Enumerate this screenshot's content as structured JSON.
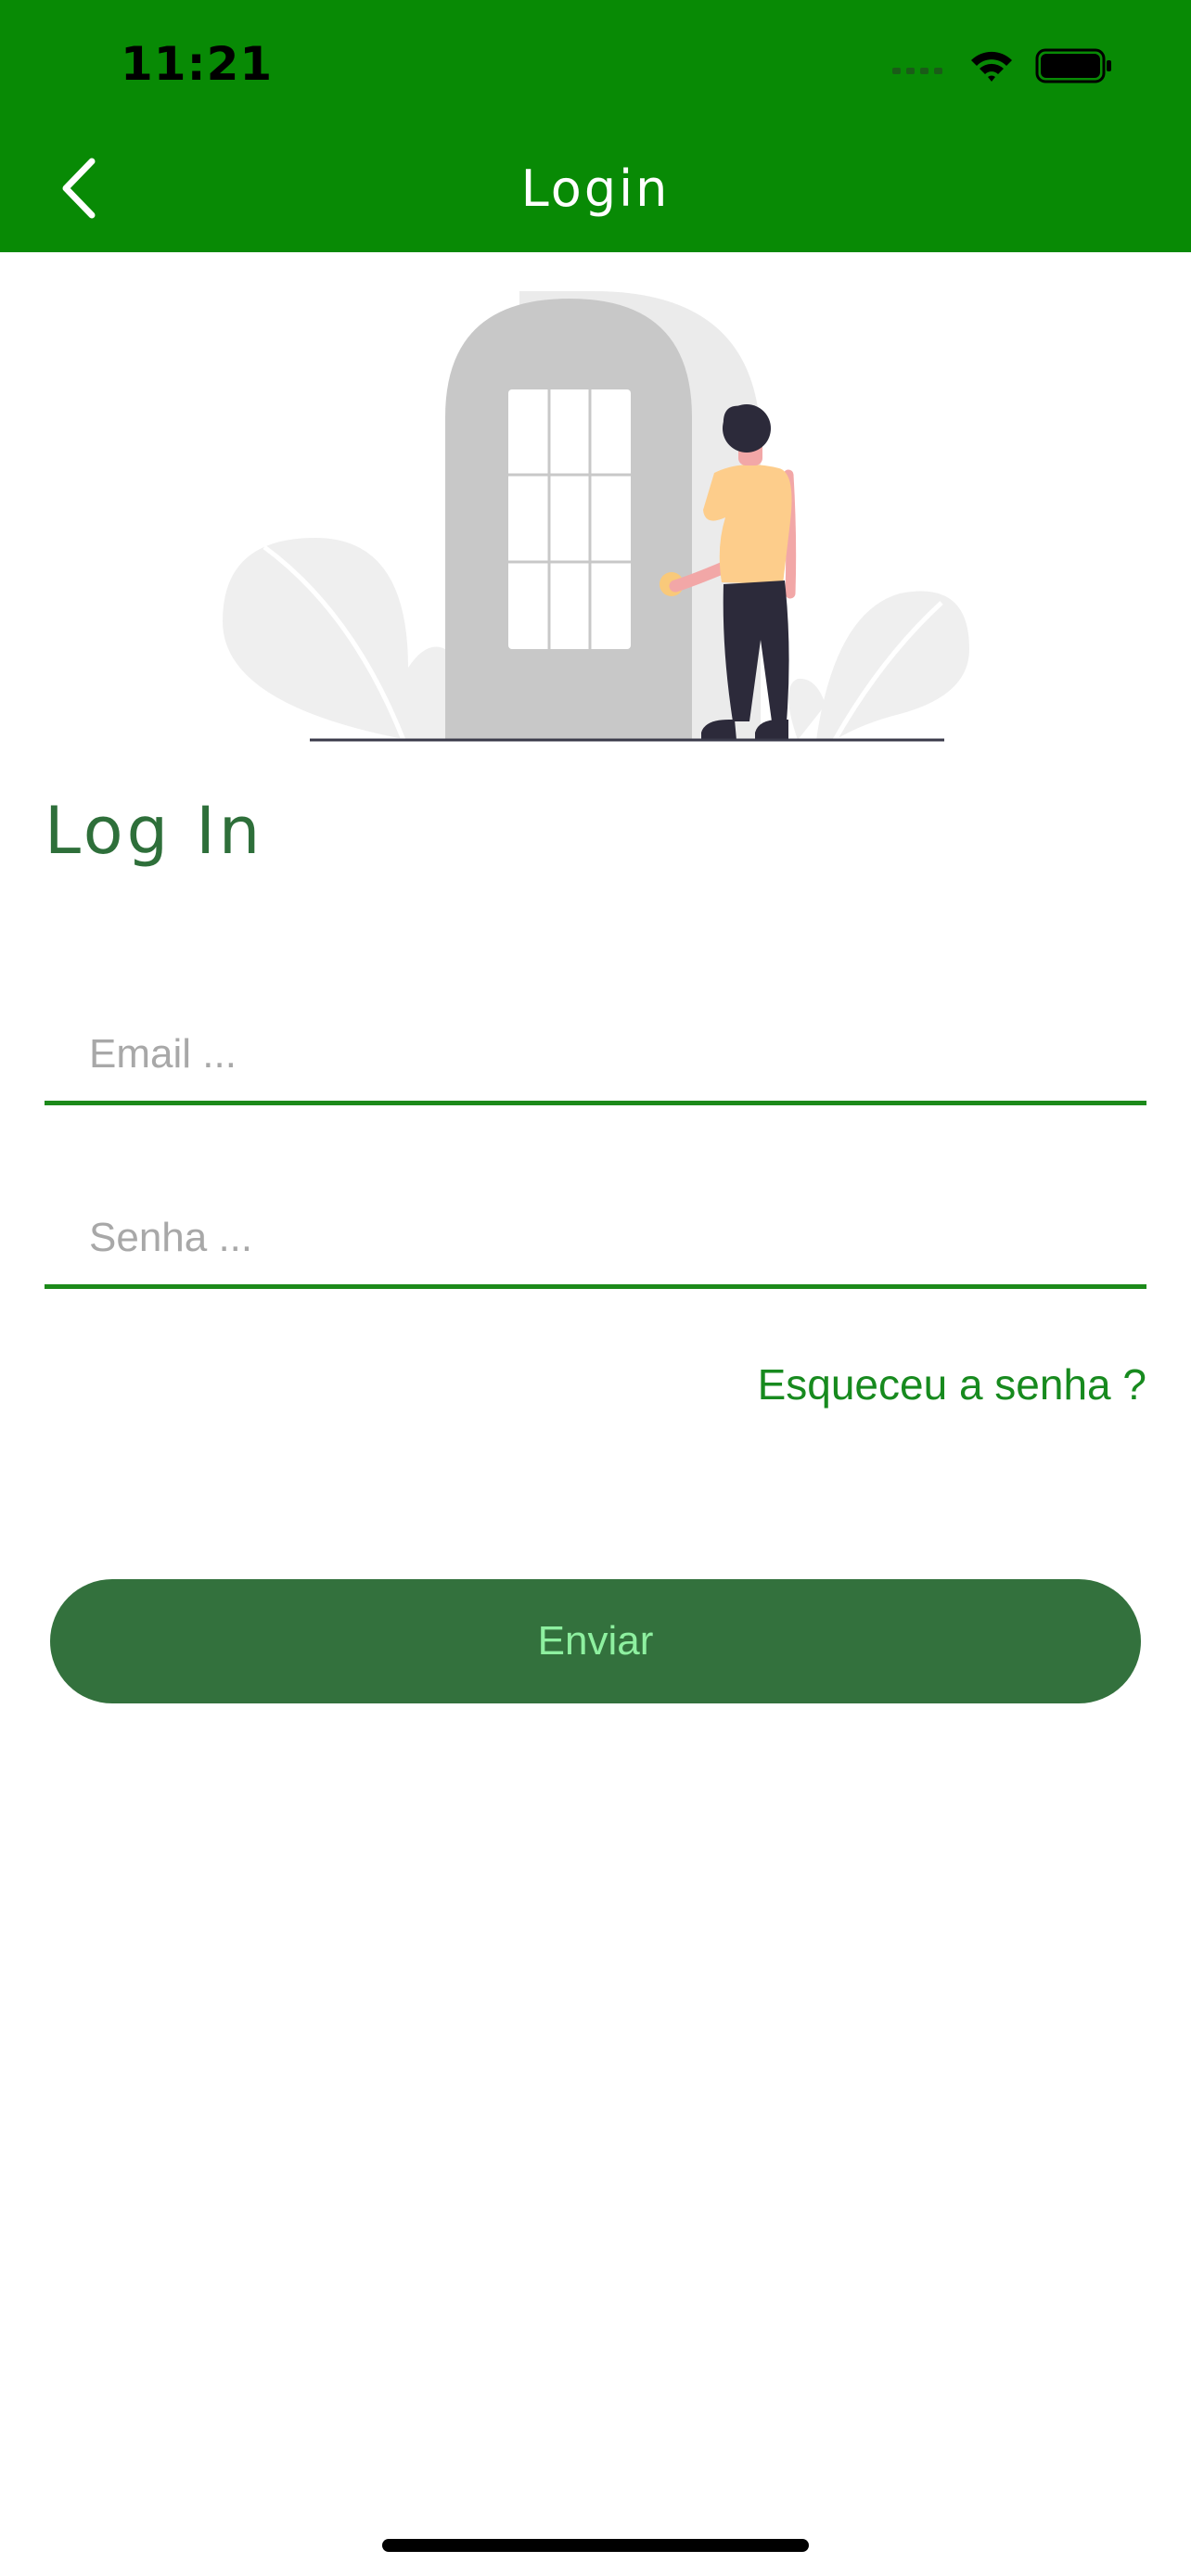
{
  "status_bar": {
    "time": "11:21",
    "icons": [
      "cellular-signal-icon",
      "wifi-icon",
      "battery-icon"
    ]
  },
  "nav": {
    "title": "Login",
    "back_icon": "chevron-left-icon"
  },
  "illustration": {
    "subject": "person-at-door"
  },
  "form": {
    "heading": "Log In",
    "email_placeholder": "Email ...",
    "email_value": "",
    "password_placeholder": "Senha ...",
    "password_value": "",
    "forgot_label": "Esqueceu a senha ?",
    "submit_label": "Enviar"
  },
  "colors": {
    "header": "#088a05",
    "accent": "#1c8a1a",
    "button": "#33713d",
    "button_text": "#8ef0a0",
    "heading": "#2e6f3a"
  }
}
